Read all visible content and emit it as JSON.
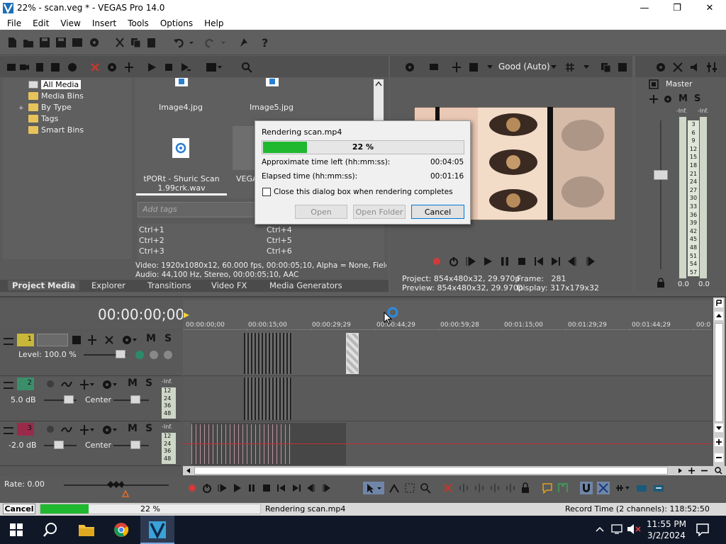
{
  "window": {
    "title": "22% - scan.veg * - VEGAS Pro 14.0",
    "minimize": "—",
    "maximize": "❐",
    "close": "✕"
  },
  "menu": [
    "File",
    "Edit",
    "View",
    "Insert",
    "Tools",
    "Options",
    "Help"
  ],
  "media_panel": {
    "tree": [
      "All Media",
      "Media Bins",
      "By Type",
      "Tags",
      "Smart Bins"
    ],
    "expander": "+",
    "items": [
      {
        "caption": "Image4.jpg"
      },
      {
        "caption": "Image5.jpg"
      },
      {
        "caption": "tPORt - Shuric Scan 1.99crk.wav"
      },
      {
        "caption": "VEGA"
      }
    ],
    "tags_placeholder": "Add tags",
    "shortcuts_left": [
      "Ctrl+1",
      "Ctrl+2",
      "Ctrl+3"
    ],
    "shortcuts_right": [
      "Ctrl+4",
      "Ctrl+5",
      "Ctrl+6"
    ],
    "info_video": "Video: 1920x1080x12, 60.000 fps, 00:00:05;10, Alpha = None, Field Orc",
    "info_audio": "Audio: 44,100 Hz, Stereo, 00:00:05;10, AAC",
    "tabs": [
      "Project Media",
      "Explorer",
      "Transitions",
      "Video FX",
      "Media Generators"
    ]
  },
  "preview": {
    "quality": "Good (Auto)",
    "project_label": "Project:",
    "project_value": "854x480x32, 29.970p",
    "preview_label": "Preview:",
    "preview_value": "854x480x32, 29.970p",
    "frame_label": "Frame:",
    "frame_value": "281",
    "display_label": "Display:",
    "display_value": "317x179x32"
  },
  "master": {
    "label": "Master",
    "m": "M",
    "s": "S",
    "inf_left": "-Inf.",
    "inf_right": "-Inf.",
    "scale": [
      "3",
      "6",
      "9",
      "12",
      "15",
      "18",
      "21",
      "24",
      "27",
      "30",
      "33",
      "36",
      "39",
      "42",
      "45",
      "48",
      "51",
      "54",
      "57"
    ],
    "value_left": "0.0",
    "value_right": "0.0"
  },
  "render_dialog": {
    "title": "Rendering scan.mp4",
    "progress_percent": 22,
    "progress_label": "22 %",
    "time_left_label": "Approximate time left (hh:mm:ss):",
    "time_left_value": "00:04:05",
    "elapsed_label": "Elapsed time (hh:mm:ss):",
    "elapsed_value": "00:01:16",
    "checkbox_label": "Close this dialog box when rendering completes",
    "open_button": "Open",
    "open_folder_button": "Open Folder",
    "cancel_button": "Cancel"
  },
  "timeline": {
    "timecode": "00:00:00;00",
    "ruler": [
      "00:00:00;00",
      "00:00:15;00",
      "00:00:29;29",
      "00:00:44;29",
      "00:00:59;28",
      "00:01:15;00",
      "00:01:29;29",
      "00:01:44;29",
      "00:0"
    ],
    "tracks": [
      {
        "number": "1",
        "level": "Level: 100.0 %",
        "m": "M",
        "s": "S"
      },
      {
        "number": "2",
        "volume": "5.0 dB",
        "pan": "Center",
        "m": "M",
        "s": "S",
        "inf": "-Inf.",
        "scale": [
          "12",
          "24",
          "36",
          "48"
        ]
      },
      {
        "number": "3",
        "volume": "-2.0 dB",
        "pan": "Center",
        "m": "M",
        "s": "S",
        "inf": "-Inf.",
        "scale": [
          "12",
          "24",
          "36",
          "48"
        ]
      }
    ],
    "rate": "Rate: 0.00"
  },
  "statusbar": {
    "cancel": "Cancel",
    "progress_percent": 22,
    "progress_label": "22 %",
    "rendering": "Rendering scan.mp4",
    "record_time": "Record Time (2 channels): 118:52:50"
  },
  "taskbar": {
    "time": "11:55 PM",
    "date": "3/2/2024"
  },
  "colors": {
    "progress_green": "#1fb82f",
    "track1": "#c9b73a",
    "track2": "#3a8f6a",
    "track3": "#9a2a4a"
  }
}
